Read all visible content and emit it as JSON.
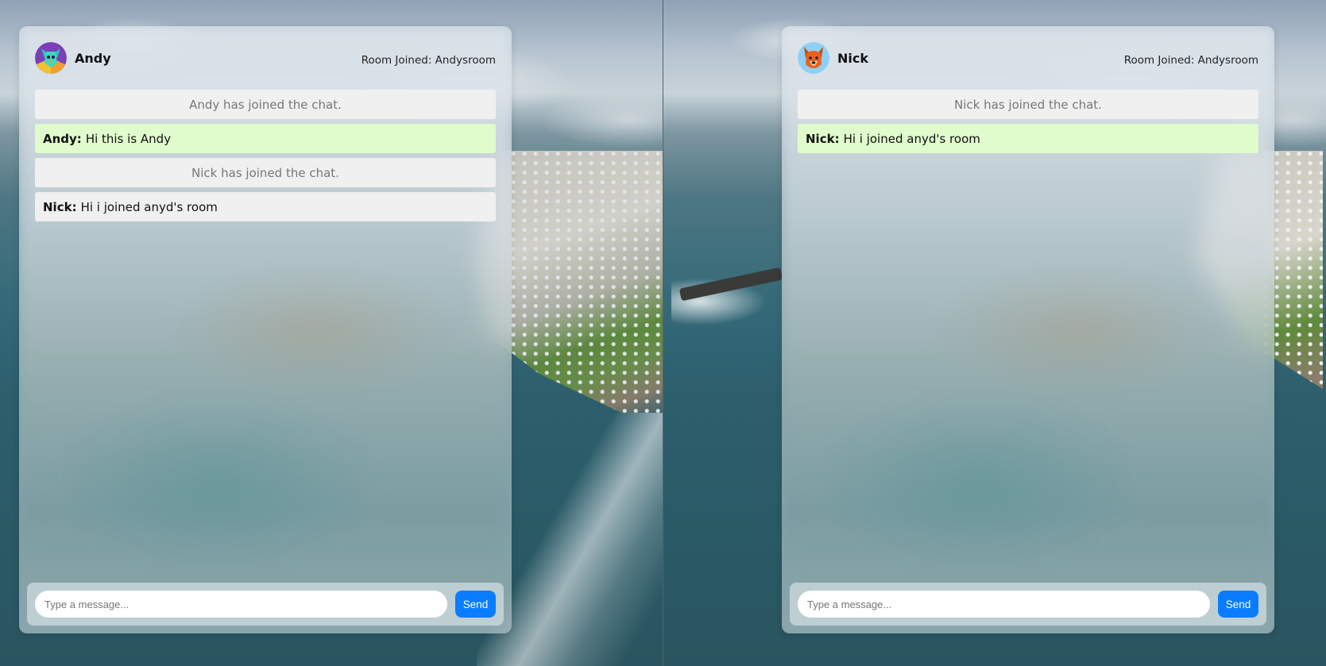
{
  "windows": [
    {
      "user": {
        "name": "Andy",
        "avatar_icon": "bird-avatar-icon"
      },
      "room_label": "Room Joined: Andysroom",
      "messages": [
        {
          "type": "system",
          "text": "Andy has joined the chat."
        },
        {
          "type": "own",
          "sender": "Andy:",
          "text": "Hi this is Andy"
        },
        {
          "type": "system",
          "text": "Nick has joined the chat."
        },
        {
          "type": "other",
          "sender": "Nick:",
          "text": "Hi i joined anyd's room"
        }
      ],
      "composer": {
        "placeholder": "Type a message...",
        "send_label": "Send"
      }
    },
    {
      "user": {
        "name": "Nick",
        "avatar_icon": "dog-avatar-icon"
      },
      "room_label": "Room Joined: Andysroom",
      "messages": [
        {
          "type": "system",
          "text": "Nick has joined the chat."
        },
        {
          "type": "own",
          "sender": "Nick:",
          "text": "Hi i joined anyd's room"
        }
      ],
      "composer": {
        "placeholder": "Type a message...",
        "send_label": "Send"
      }
    }
  ],
  "colors": {
    "own_message_bg": "#e0fbcc",
    "other_message_bg": "#f0f0f0",
    "send_button_bg": "#0a7cff"
  }
}
